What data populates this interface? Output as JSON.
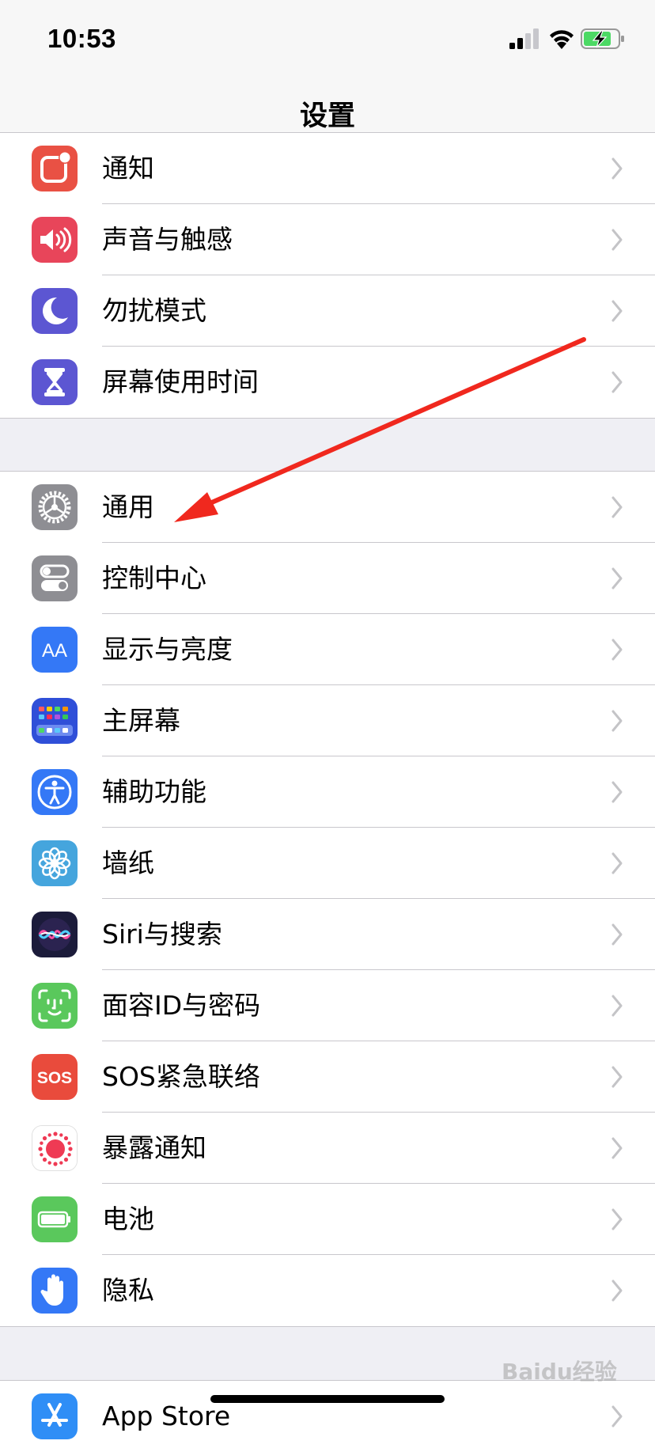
{
  "status": {
    "time": "10:53"
  },
  "nav": {
    "title": "设置"
  },
  "group1": [
    {
      "label": "通知",
      "icon": "notifications-icon",
      "color": "#e95144"
    },
    {
      "label": "声音与触感",
      "icon": "speaker-icon",
      "color": "#e8455a"
    },
    {
      "label": "勿扰模式",
      "icon": "moon-icon",
      "color": "#5c56d2"
    },
    {
      "label": "屏幕使用时间",
      "icon": "hourglass-icon",
      "color": "#5c56d2"
    }
  ],
  "group2": [
    {
      "label": "通用",
      "icon": "gear-icon",
      "color": "#8e8e93"
    },
    {
      "label": "控制中心",
      "icon": "toggles-icon",
      "color": "#8e8e93"
    },
    {
      "label": "显示与亮度",
      "icon": "text-size-icon",
      "color": "#3478f6"
    },
    {
      "label": "主屏幕",
      "icon": "home-grid-icon",
      "color": "#2f4fd8"
    },
    {
      "label": "辅助功能",
      "icon": "accessibility-icon",
      "color": "#3478f6"
    },
    {
      "label": "墙纸",
      "icon": "flower-icon",
      "color": "#45a5dd"
    },
    {
      "label": "Siri与搜索",
      "icon": "siri-icon",
      "color": "#1b1b3a"
    },
    {
      "label": "面容ID与密码",
      "icon": "face-id-icon",
      "color": "#5ac85c"
    },
    {
      "label": "SOS紧急联络",
      "icon": "sos-icon",
      "color": "#e94b3c"
    },
    {
      "label": "暴露通知",
      "icon": "exposure-icon",
      "color": "#ffffff"
    },
    {
      "label": "电池",
      "icon": "battery-icon",
      "color": "#5ac85c"
    },
    {
      "label": "隐私",
      "icon": "hand-icon",
      "color": "#3478f6"
    }
  ],
  "group3": [
    {
      "label": "App Store",
      "icon": "app-store-icon",
      "color": "#2f8ef6"
    }
  ],
  "sos_text": "SOS",
  "text_size_glyph": "AA",
  "watermark": "Baidu经验"
}
